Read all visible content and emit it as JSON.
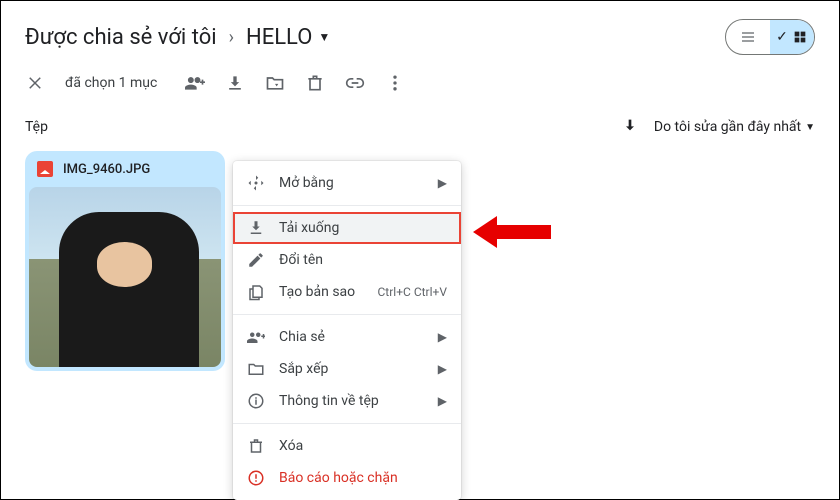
{
  "breadcrumb": {
    "shared": "Được chia sẻ với tôi",
    "current": "HELLO"
  },
  "toolbar": {
    "selection_text": "đã chọn 1 mục"
  },
  "section": {
    "files_label": "Tệp",
    "sort_label": "Do tôi sửa gần đây nhất"
  },
  "file": {
    "name": "IMG_9460.JPG"
  },
  "menu": {
    "open_with": "Mở bằng",
    "download": "Tải xuống",
    "rename": "Đổi tên",
    "make_copy": "Tạo bản sao",
    "copy_shortcut": "Ctrl+C Ctrl+V",
    "share": "Chia sẻ",
    "organize": "Sắp xếp",
    "file_info": "Thông tin về tệp",
    "trash": "Xóa",
    "report": "Báo cáo hoặc chặn"
  }
}
